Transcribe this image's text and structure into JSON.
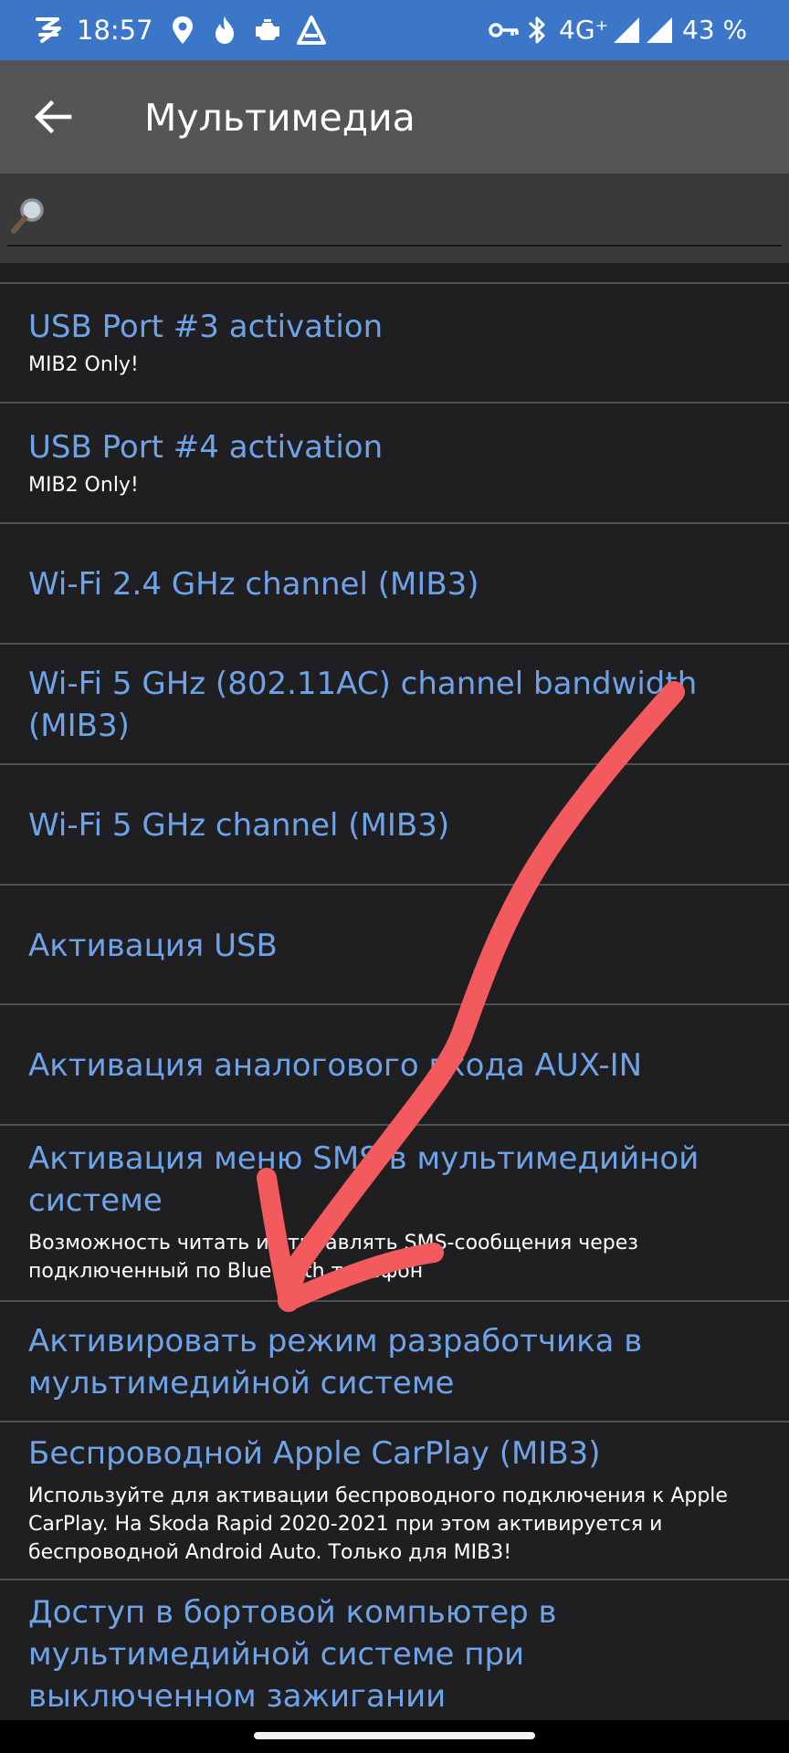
{
  "status_bar": {
    "time": "18:57",
    "network": "4G⁺",
    "battery": "43 %",
    "left_icons": [
      "app-logo-icon",
      "location-icon",
      "flame-icon",
      "car-engine-icon",
      "drive-icon"
    ],
    "right_icons": [
      "key-icon",
      "bluetooth-icon",
      "signal-icon",
      "signal-icon"
    ]
  },
  "toolbar": {
    "title": "Мультимедиа"
  },
  "search": {
    "placeholder": "",
    "value": ""
  },
  "items": [
    {
      "title": "USB Port #3 activation",
      "subtitle": "MIB2 Only!"
    },
    {
      "title": "USB Port #4 activation",
      "subtitle": "MIB2 Only!"
    },
    {
      "title": "Wi-Fi 2.4 GHz channel (MIB3)"
    },
    {
      "title": "Wi-Fi 5 GHz (802.11AC) channel bandwidth (MIB3)"
    },
    {
      "title": "Wi-Fi 5 GHz channel (MIB3)"
    },
    {
      "title": "Активация USB"
    },
    {
      "title": "Активация аналогового входа AUX-IN"
    },
    {
      "title": "Активация меню SMS в мультимедийной системе",
      "subtitle": "Возможность читать и отправлять SMS-сообщения через подключенный по Bluetooth телефон"
    },
    {
      "title": "Активировать режим разработчика в мультимедийной системе"
    },
    {
      "title": "Беспроводной Apple CarPlay (MIB3)",
      "subtitle": "Используйте для активации беспроводного подключения к Apple CarPlay. На Skoda Rapid 2020-2021 при этом активируется и беспроводной Android Auto. Только для MIB3!"
    },
    {
      "title": "Доступ в бортовой компьютер в мультимедийной системе при выключенном зажигании"
    }
  ],
  "colors": {
    "status_bar": "#3b76c8",
    "toolbar": "#555555",
    "background": "#1f1e21",
    "link_text": "#6fa3e8",
    "annotation_arrow": "#f25a5e"
  }
}
